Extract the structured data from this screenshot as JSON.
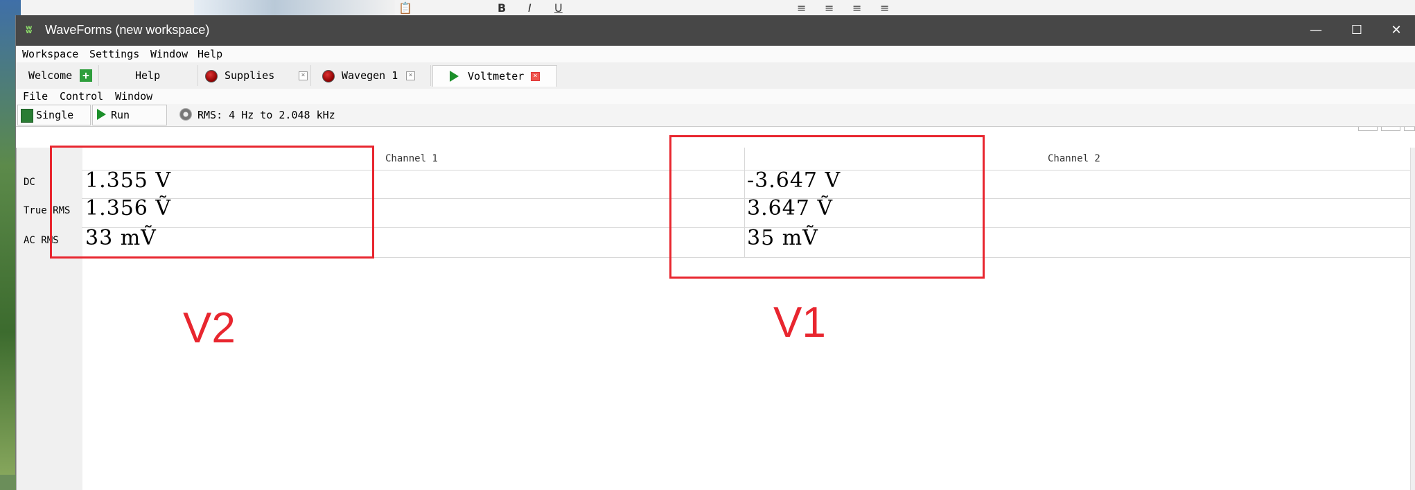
{
  "window": {
    "title": "WaveForms (new workspace)",
    "minimize": "—",
    "maximize": "☐",
    "close": "✕"
  },
  "menu": {
    "workspace": "Workspace",
    "settings": "Settings",
    "window": "Window",
    "help": "Help"
  },
  "tabs": [
    {
      "label": "Welcome"
    },
    {
      "label": "Help"
    },
    {
      "label": "Supplies"
    },
    {
      "label": "Wavegen 1"
    },
    {
      "label": "Voltmeter"
    }
  ],
  "submenu": {
    "file": "File",
    "control": "Control",
    "window": "Window"
  },
  "toolbar": {
    "single_label": "Single",
    "run_label": "Run",
    "rms_info": "RMS: 4 Hz to 2.048 kHz"
  },
  "voltmeter": {
    "row_labels": [
      "DC",
      "True RMS",
      "AC RMS"
    ],
    "channels": [
      {
        "header": "Channel 1",
        "dc": "1.355 V",
        "true_rms": "1.356 Ṽ",
        "ac_rms": "33 mṼ"
      },
      {
        "header": "Channel 2",
        "dc": "-3.647 V",
        "true_rms": "3.647 Ṽ",
        "ac_rms": "35 mṼ"
      }
    ]
  },
  "annotations": {
    "left_label": "V2",
    "right_label": "V1",
    "color": "#e8262f"
  }
}
